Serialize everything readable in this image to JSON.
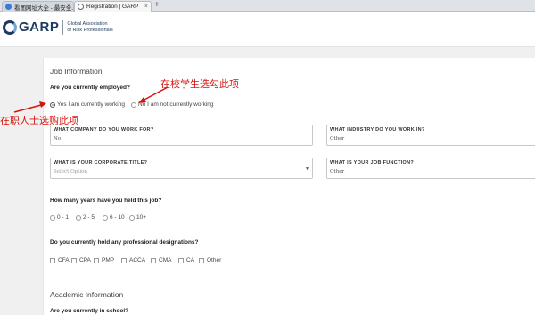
{
  "browser": {
    "tabs": [
      {
        "label": "看图网址大全 - 最安全..."
      },
      {
        "label": "Registration | GARP"
      }
    ],
    "new_tab": "+"
  },
  "header": {
    "logo_text": "GARP",
    "logo_subtitle_line1": "Global Association",
    "logo_subtitle_line2": "of Risk Professionals"
  },
  "job": {
    "section_title": "Job Information",
    "employed_question": "Are you currently employed?",
    "employed_yes": "Yes I am currently working",
    "employed_no": "No I am not currently working",
    "company_label": "WHAT COMPANY DO YOU WORK FOR?",
    "company_value": "No",
    "industry_label": "WHAT INDUSTRY DO YOU WORK IN?",
    "industry_value": "Other",
    "title_label": "WHAT IS YOUR CORPORATE TITLE?",
    "title_placeholder": "Select Option",
    "function_label": "WHAT IS YOUR JOB FUNCTION?",
    "function_value": "Other",
    "years_question": "How many years have you held this job?",
    "years_options": [
      "0 - 1",
      "2 - 5",
      "6 - 10",
      "10+"
    ],
    "designations_question": "Do you currently hold any professional designations?",
    "designations": [
      "CFA",
      "CPA",
      "PMP",
      "ACCA",
      "CMA",
      "CA",
      "Other"
    ]
  },
  "academic": {
    "section_title": "Academic Information",
    "school_question": "Are you currently in school?"
  },
  "annotations": {
    "student": "在校学生选勾此项",
    "employed": "在职人士选购此项"
  }
}
